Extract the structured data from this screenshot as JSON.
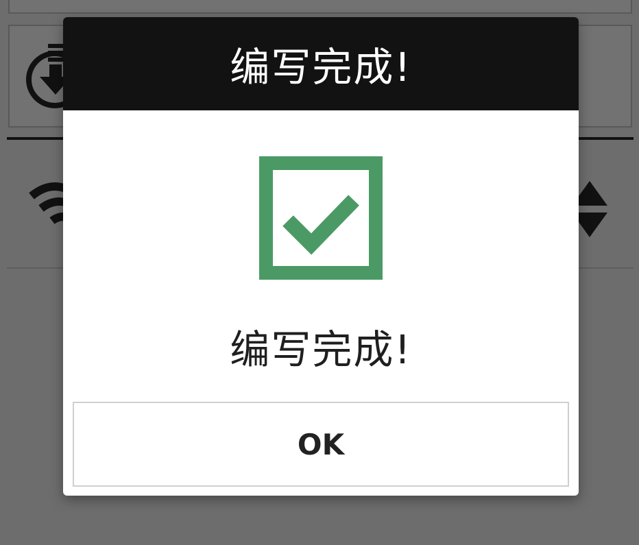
{
  "dialog": {
    "title": "编写完成!",
    "message": "编写完成!",
    "icon": "check-box-icon",
    "ok_label": "OK"
  },
  "background": {
    "icons": [
      "download-icon",
      "wifi-icon",
      "sort-icon"
    ]
  },
  "colors": {
    "check_green": "#4b9a65",
    "header_bg": "#121212",
    "overlay_bg": "#6d6d6d"
  }
}
